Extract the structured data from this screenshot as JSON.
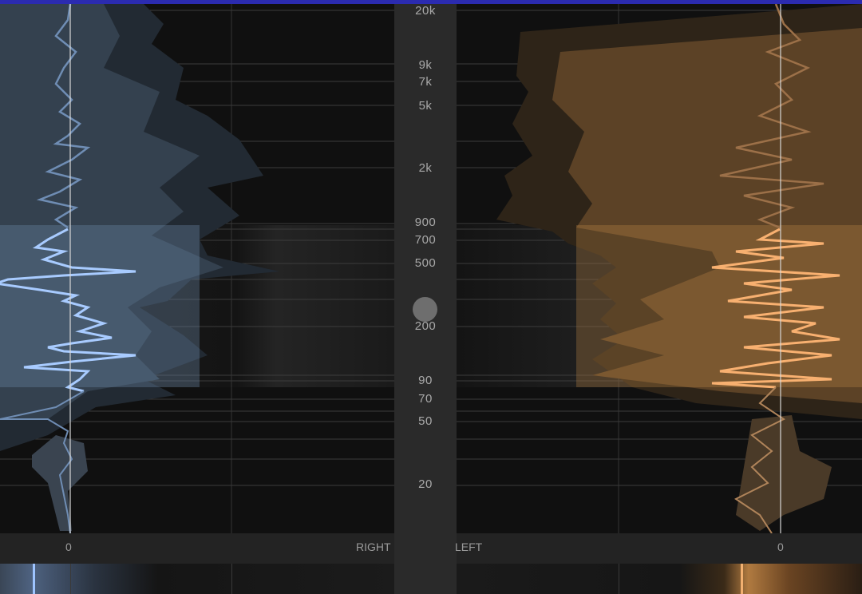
{
  "freq_scale": [
    "20k",
    "9k",
    "7k",
    "5k",
    "2k",
    "900",
    "700",
    "500",
    "200",
    "90",
    "70",
    "50",
    "20"
  ],
  "left_channel": {
    "label": "RIGHT",
    "zero": "0",
    "accent": "#8ab0ff"
  },
  "right_channel": {
    "label": "LEFT",
    "zero": "0",
    "accent": "#f0a860"
  },
  "colors": {
    "top_bar": "#2b2bb0",
    "band_highlight": "#ffffff"
  }
}
